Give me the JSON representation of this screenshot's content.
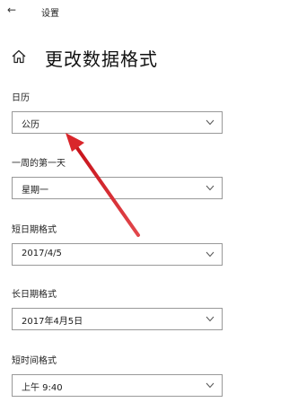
{
  "window": {
    "title": "设置",
    "back_icon": "back-arrow-icon"
  },
  "page": {
    "title": "更改数据格式",
    "icon": "home-icon"
  },
  "fields": [
    {
      "label": "日历",
      "value": "公历"
    },
    {
      "label": "一周的第一天",
      "value": "星期一"
    },
    {
      "label": "短日期格式",
      "value": "2017/4/5"
    },
    {
      "label": "长日期格式",
      "value": "2017年4月5日"
    },
    {
      "label": "短时间格式",
      "value": "上午 9:40"
    }
  ],
  "annotation": {
    "icon": "red-pointer-arrow",
    "color": "#d9262b"
  }
}
